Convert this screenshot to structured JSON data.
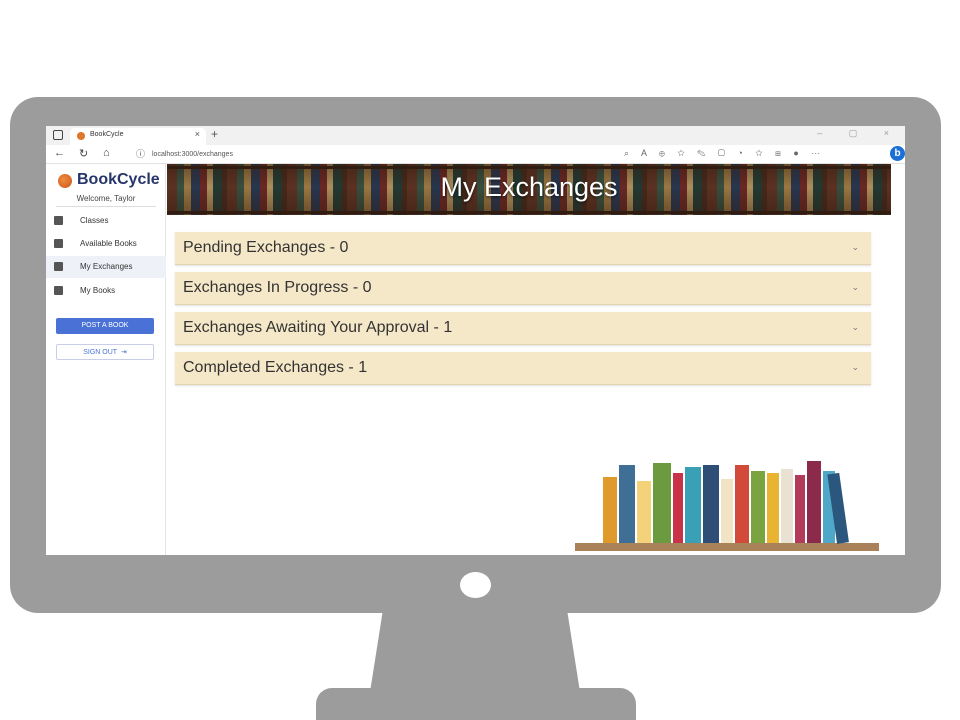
{
  "browser": {
    "tab_title": "BookCycle",
    "tab_close": "×",
    "new_tab": "+",
    "window_controls": "– ▢ ×",
    "url": "localhost:3000/exchanges"
  },
  "sidebar": {
    "brand_name": "BookCycle",
    "welcome": "Welcome, Taylor",
    "items": [
      {
        "label": "Classes",
        "icon": "school-icon",
        "active": false
      },
      {
        "label": "Available Books",
        "icon": "library-icon",
        "active": false
      },
      {
        "label": "My Exchanges",
        "icon": "exchange-icon",
        "active": true
      },
      {
        "label": "My Books",
        "icon": "book-icon",
        "active": false
      }
    ],
    "post_button": "POST A BOOK",
    "signout_button": "SIGN OUT"
  },
  "main": {
    "banner_title": "My Exchanges",
    "sections": [
      {
        "title": "Pending Exchanges - 0"
      },
      {
        "title": "Exchanges In Progress - 0"
      },
      {
        "title": "Exchanges Awaiting Your Approval - 1"
      },
      {
        "title": "Completed Exchanges - 1"
      }
    ]
  },
  "colors": {
    "accent": "#4a72d6",
    "brand_text": "#27366a",
    "accordion_bg": "#f5e8c8",
    "monitor": "#9c9c9c"
  }
}
